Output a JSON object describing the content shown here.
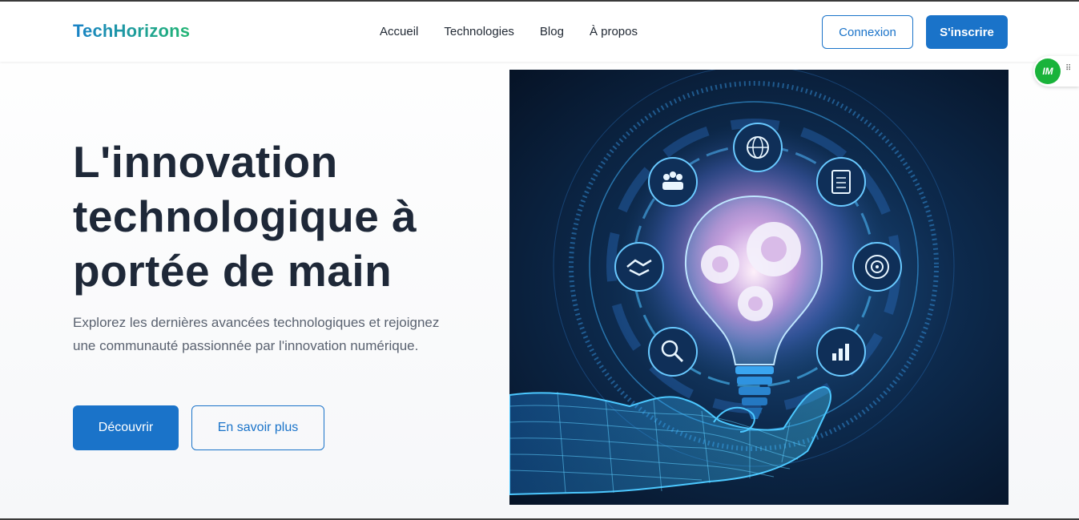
{
  "header": {
    "logo": "TechHorizons",
    "nav": [
      "Accueil",
      "Technologies",
      "Blog",
      "À propos"
    ],
    "login_label": "Connexion",
    "signup_label": "S'inscrire"
  },
  "hero": {
    "title_line1": "L'innovation",
    "title_line2": "technologique à",
    "title_line3": "portée de main",
    "description": "Explorez les dernières avancées technologiques et rejoignez une communauté passionnée par l'innovation numérique.",
    "primary_button": "Découvrir",
    "secondary_button": "En savoir plus",
    "image_icons": [
      "globe-icon",
      "clipboard-icon",
      "target-icon",
      "bar-chart-icon",
      "magnifier-icon",
      "handshake-icon",
      "team-icon",
      "gears-icon",
      "lightbulb-icon",
      "wireframe-hand-icon"
    ]
  },
  "widget": {
    "badge_text": "IM"
  },
  "colors": {
    "primary": "#1a73c9",
    "heading": "#1e2838",
    "body_text": "#5a6270",
    "logo_gradient_start": "#1a82c8",
    "logo_gradient_end": "#22b573",
    "widget_green": "#19b33a"
  }
}
